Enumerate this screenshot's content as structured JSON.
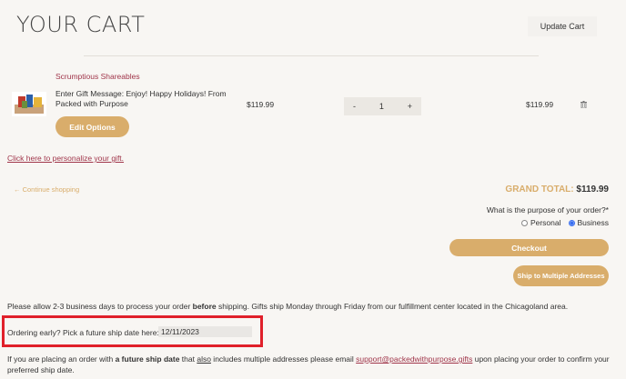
{
  "header": {
    "title": "YOUR CART",
    "update_cart_label": "Update Cart"
  },
  "cart_item": {
    "name": "Scrumptious Shareables",
    "gift_message": "Enter Gift Message: Enjoy! Happy Holidays! From Packed with Purpose",
    "edit_label": "Edit Options",
    "unit_price": "$119.99",
    "quantity": "1",
    "qty_minus": "-",
    "qty_plus": "+",
    "line_total": "$119.99"
  },
  "personalize_link": "Click here to personalize your gift.",
  "continue_shopping": "Continue shopping",
  "summary": {
    "grand_total_label": "GRAND TOTAL:",
    "grand_total_value": "$119.99",
    "purpose_question": "What is the purpose of your order?*",
    "purpose_options": [
      "Personal",
      "Business"
    ],
    "selected_purpose": "Business",
    "checkout_label": "Checkout",
    "ship_multiple_label": "Ship to Multiple Addresses"
  },
  "notes": {
    "process_pre": "Please allow 2-3 business days to process your order ",
    "process_bold": "before",
    "process_post": " shipping. Gifts ship Monday through Friday from our fulfillment center located in the Chicagoland area.",
    "ship_date_label": "Ordering early? Pick a future ship date here:",
    "ship_date_value": "12/11/2023",
    "future_pre": "If you are placing an order with ",
    "future_bold": "a future ship date",
    "future_mid1": " that ",
    "future_u": "also",
    "future_mid2": " includes multiple addresses please email ",
    "future_email": "support@packedwithpurpose.gifts",
    "future_post": " upon placing your order to confirm your preferred ship date."
  },
  "colors": {
    "accent_gold": "#d9ad6b",
    "link_maroon": "#a0354a",
    "highlight_red": "#e0202a"
  }
}
